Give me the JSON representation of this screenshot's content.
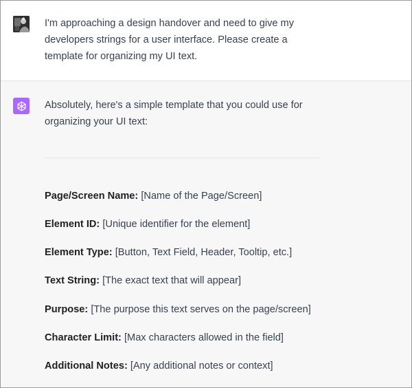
{
  "user_message": {
    "text": "I'm approaching a design handover and need to give my developers strings for a user interface. Please create a template for organizing my UI text."
  },
  "assistant_message": {
    "intro": "Absolutely, here's a simple template that you could use for organizing your UI text:",
    "fields": [
      {
        "label": "Page/Screen Name:",
        "value": "[Name of the Page/Screen]"
      },
      {
        "label": "Element ID:",
        "value": "[Unique identifier for the element]"
      },
      {
        "label": "Element Type:",
        "value": "[Button, Text Field, Header, Tooltip, etc.]"
      },
      {
        "label": "Text String:",
        "value": "[The exact text that will appear]"
      },
      {
        "label": "Purpose:",
        "value": "[The purpose this text serves on the page/screen]"
      },
      {
        "label": "Character Limit:",
        "value": "[Max characters allowed in the field]"
      },
      {
        "label": "Additional Notes:",
        "value": "[Any additional notes or context]"
      }
    ]
  },
  "icons": {
    "user_avatar": "user-avatar-photo",
    "assistant_avatar": "openai-logo-icon"
  },
  "colors": {
    "assistant_avatar_bg": "#ab68ff",
    "assistant_panel_bg": "#f7f7f8",
    "user_panel_bg": "#ffffff"
  }
}
